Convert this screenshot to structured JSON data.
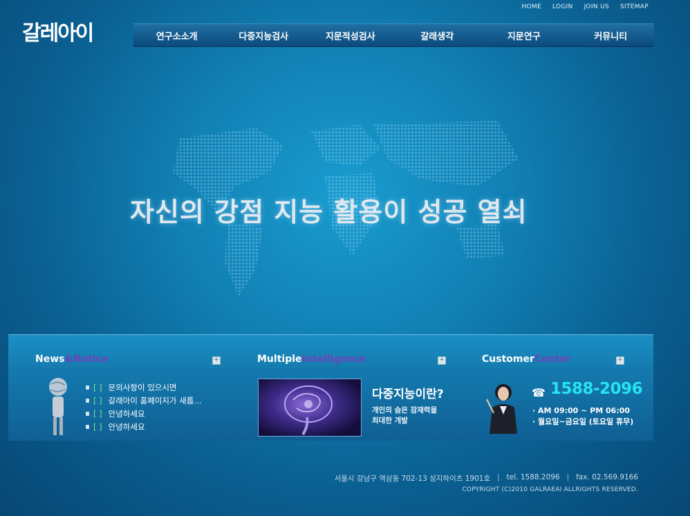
{
  "top_links": [
    "HOME",
    "LOGIN",
    "JOIN US",
    "SITEMAP"
  ],
  "logo": {
    "text": "갈레아이"
  },
  "nav": [
    "연구소소개",
    "다중지능검사",
    "지문적성검사",
    "갈래생각",
    "지문연구",
    "커뮤니티"
  ],
  "hero": {
    "slogan": "자신의 강점 지능 활용이 성공 열쇠"
  },
  "news": {
    "title_main": "News",
    "title_accent": "&Notice",
    "items": [
      "문의사항이 있으시면",
      "갈래아이 홈페이지가 새롭…",
      "안녕하세요",
      "안녕하세요"
    ]
  },
  "intelligence": {
    "title_main": "Multiple",
    "title_accent": "Intelligence",
    "heading": "다중지능이란?",
    "line1": "개인의 숨은 잠재력을",
    "line2": "최대한 개발"
  },
  "customer": {
    "title_main": "Customer",
    "title_accent": "Center",
    "phone": "1588-2096",
    "hours": "AM 09:00 ~ PM 06:00",
    "days": "월요일~금요일 (토요일 휴무)"
  },
  "footer": {
    "address": "서울시 강남구 역삼동 702-13 성지하이츠 1901호",
    "tel": "tel. 1588.2096",
    "fax": "fax. 02.569.9166",
    "copyright": "COPYRIGHT (C)2010 GALRAEAI ALLRIGHTS RESERVED."
  },
  "plus_symbol": "+",
  "separator": "|",
  "bracket": "[ ]",
  "colors": {
    "accent_cyan": "#27e3f2",
    "title_accent": "#6d45b8",
    "nav_bg": "#0c4a7c"
  }
}
